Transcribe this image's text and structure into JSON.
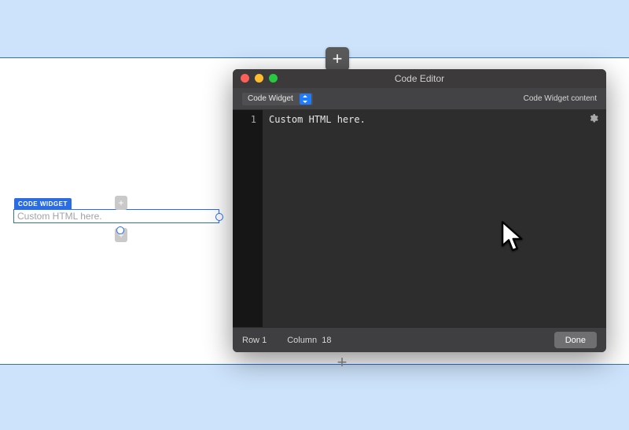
{
  "canvas": {
    "widget_label": "CODE WIDGET",
    "widget_content": "Custom HTML here."
  },
  "add_button": {
    "dark_glyph": "+",
    "light_glyph": "+"
  },
  "editor": {
    "window_title": "Code Editor",
    "dropdown_value": "Code Widget",
    "toolbar_right_label": "Code Widget content",
    "gutter_line": "1",
    "code_line": "Custom HTML here.",
    "status_row_label": "Row",
    "status_row_value": "1",
    "status_col_label": "Column",
    "status_col_value": "18",
    "done_label": "Done"
  }
}
